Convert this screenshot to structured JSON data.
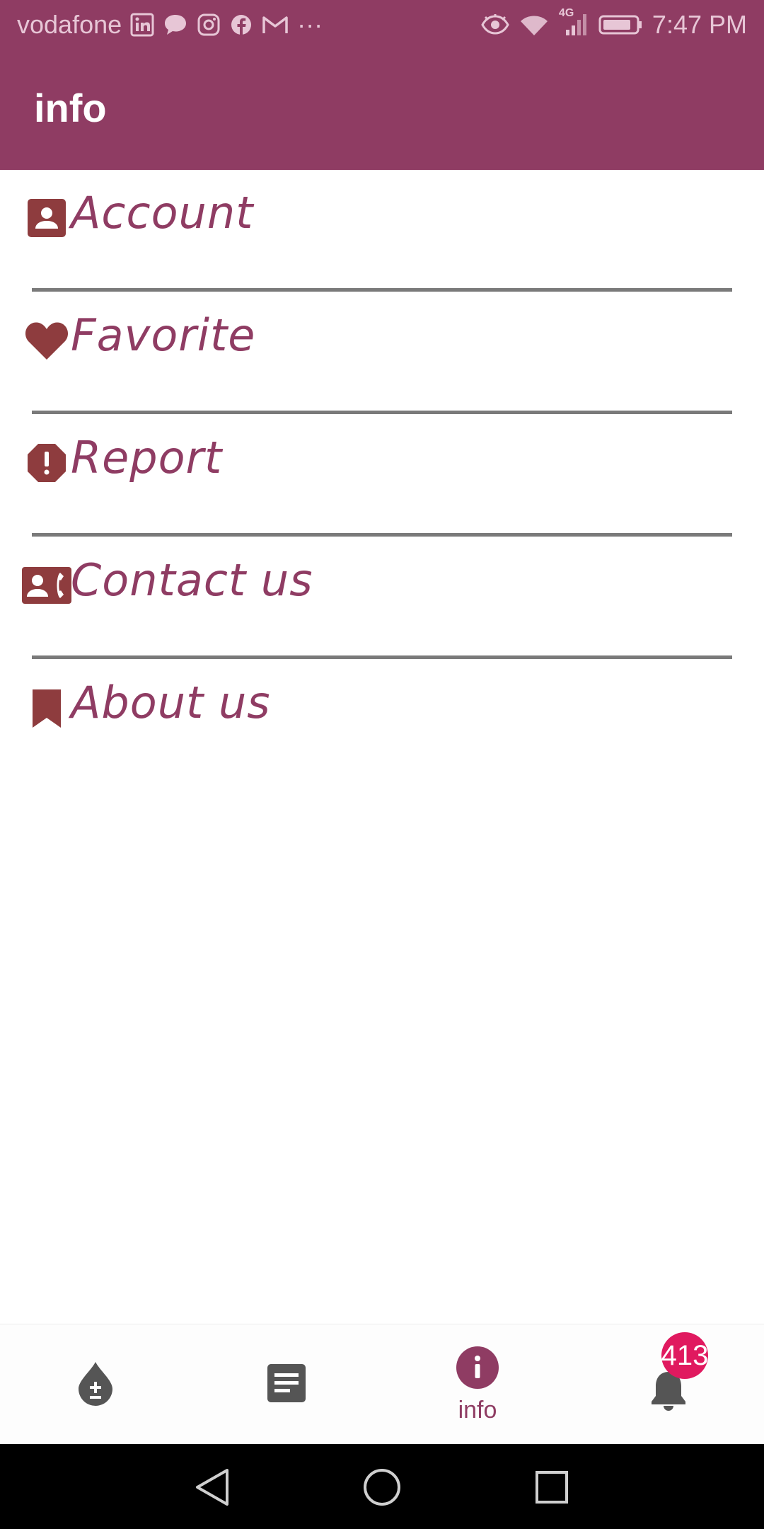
{
  "status_bar": {
    "carrier": "vodafone",
    "more": "···",
    "network": "4G",
    "time": "7:47 PM"
  },
  "app_bar": {
    "title": "info"
  },
  "menu": {
    "items": [
      {
        "label": "Account",
        "icon": "account-icon"
      },
      {
        "label": "Favorite",
        "icon": "heart-icon"
      },
      {
        "label": "Report",
        "icon": "report-alert-icon"
      },
      {
        "label": "Contact us",
        "icon": "contact-phone-icon"
      },
      {
        "label": "About us",
        "icon": "bookmark-icon"
      }
    ]
  },
  "bottom_nav": {
    "items": [
      {
        "icon": "blood-drop-icon",
        "label": ""
      },
      {
        "icon": "article-icon",
        "label": ""
      },
      {
        "icon": "info-icon",
        "label": "info",
        "active": true
      },
      {
        "icon": "bell-icon",
        "label": ""
      }
    ],
    "notification_count": "413"
  },
  "colors": {
    "primary": "#8f3c63",
    "icon": "#8e3c3e",
    "badge": "#e0195f",
    "divider": "#7a7a7a"
  }
}
